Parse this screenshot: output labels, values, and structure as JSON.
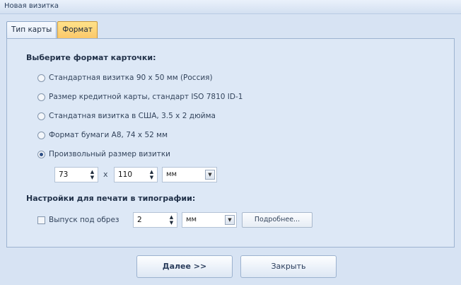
{
  "window": {
    "title": "Новая визитка"
  },
  "tabs": [
    {
      "label": "Тип карты",
      "active": false
    },
    {
      "label": "Формат",
      "active": true
    }
  ],
  "format_section": {
    "title": "Выберите формат карточки:",
    "options": [
      {
        "label": "Стандартная визитка 90 x 50 мм (Россия)",
        "selected": false
      },
      {
        "label": "Размер кредитной карты, стандарт ISO 7810 ID-1",
        "selected": false
      },
      {
        "label": "Стандатная визитка в США, 3.5 x 2 дюйма",
        "selected": false
      },
      {
        "label": "Формат бумаги A8, 74 x 52 мм",
        "selected": false
      },
      {
        "label": "Произвольный размер визитки",
        "selected": true
      }
    ],
    "custom": {
      "width": "73",
      "height": "110",
      "separator": "x",
      "unit": "мм"
    }
  },
  "print_section": {
    "title": "Настройки для печати в типографии:",
    "bleed_label": "Выпуск под обрез",
    "bleed_checked": false,
    "bleed_value": "2",
    "bleed_unit": "мм",
    "details_button": "Подробнее..."
  },
  "footer": {
    "next_button": "Далее >>",
    "close_button": "Закрыть"
  },
  "icons": {
    "spin_arrows": "up-down-triangles",
    "dropdown": "down-triangle"
  }
}
